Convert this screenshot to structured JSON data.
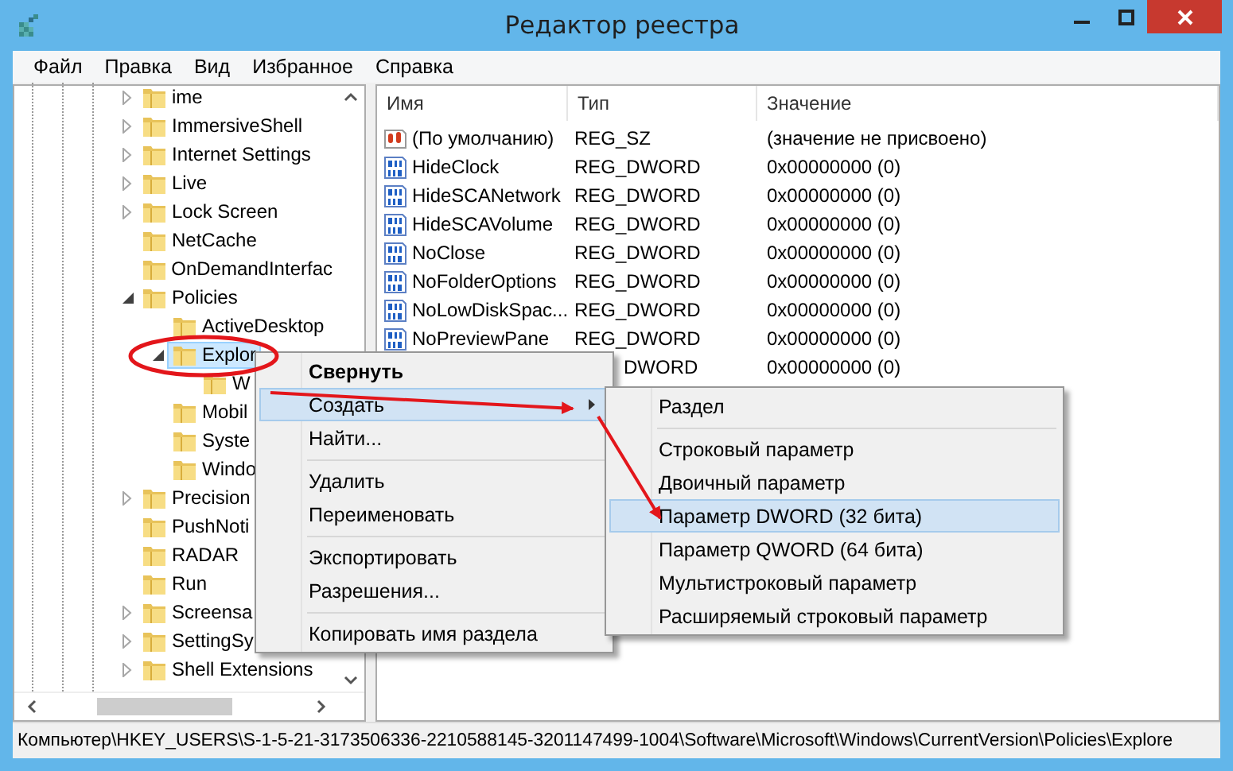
{
  "window": {
    "title": "Редактор реестра"
  },
  "menu_bar": [
    "Файл",
    "Правка",
    "Вид",
    "Избранное",
    "Справка"
  ],
  "tree": {
    "items": [
      {
        "label": "ime",
        "expanded": false,
        "selected": false
      },
      {
        "label": "ImmersiveShell",
        "expanded": false,
        "selected": false
      },
      {
        "label": "Internet Settings",
        "expanded": false,
        "selected": false
      },
      {
        "label": "Live",
        "expanded": false,
        "selected": false
      },
      {
        "label": "Lock Screen",
        "expanded": false,
        "selected": false
      },
      {
        "label": "NetCache",
        "selected": false
      },
      {
        "label": "OnDemandInterfac",
        "selected": false
      },
      {
        "label": "Policies",
        "expanded": true,
        "selected": false,
        "children": [
          {
            "label": "ActiveDesktop",
            "selected": false
          },
          {
            "label": "Explor",
            "expanded": true,
            "selected": true,
            "children": [
              {
                "label": "W",
                "selected": false
              }
            ]
          },
          {
            "label": "Mobil",
            "selected": false
          },
          {
            "label": "Syste",
            "selected": false
          },
          {
            "label": "Windo",
            "selected": false
          }
        ]
      },
      {
        "label": "Precision",
        "expanded": false,
        "selected": false
      },
      {
        "label": "PushNoti",
        "selected": false
      },
      {
        "label": "RADAR",
        "selected": false
      },
      {
        "label": "Run",
        "selected": false
      },
      {
        "label": "Screensa",
        "expanded": false,
        "selected": false
      },
      {
        "label": "SettingSy",
        "expanded": false,
        "selected": false
      },
      {
        "label": "Shell Extensions",
        "expanded": false,
        "selected": false
      }
    ]
  },
  "list": {
    "columns": [
      "Имя",
      "Тип",
      "Значение"
    ],
    "rows": [
      {
        "kind": "string",
        "name": "(По умолчанию)",
        "type": "REG_SZ",
        "value": "(значение не присвоено)"
      },
      {
        "kind": "dword",
        "name": "HideClock",
        "type": "REG_DWORD",
        "value": "0x00000000 (0)"
      },
      {
        "kind": "dword",
        "name": "HideSCANetwork",
        "type": "REG_DWORD",
        "value": "0x00000000 (0)"
      },
      {
        "kind": "dword",
        "name": "HideSCAVolume",
        "type": "REG_DWORD",
        "value": "0x00000000 (0)"
      },
      {
        "kind": "dword",
        "name": "NoClose",
        "type": "REG_DWORD",
        "value": "0x00000000 (0)"
      },
      {
        "kind": "dword",
        "name": "NoFolderOptions",
        "type": "REG_DWORD",
        "value": "0x00000000 (0)"
      },
      {
        "kind": "dword",
        "name": "NoLowDiskSpac...",
        "type": "REG_DWORD",
        "value": "0x00000000 (0)"
      },
      {
        "kind": "dword",
        "name": "NoPreviewPane",
        "type": "REG_DWORD",
        "value": "0x00000000 (0)"
      },
      {
        "kind": "hidden",
        "type": "DWORD",
        "value": "0x00000000 (0)"
      }
    ]
  },
  "context_menu": {
    "items": [
      {
        "kind": "item",
        "label": "Свернуть",
        "default": true,
        "selected": false,
        "submenu": false
      },
      {
        "kind": "item",
        "label": "Создать",
        "default": false,
        "selected": true,
        "submenu": true
      },
      {
        "kind": "item",
        "label": "Найти...",
        "default": false,
        "selected": false,
        "submenu": false
      },
      {
        "kind": "separator"
      },
      {
        "kind": "item",
        "label": "Удалить",
        "default": false,
        "selected": false,
        "submenu": false
      },
      {
        "kind": "item",
        "label": "Переименовать",
        "default": false,
        "selected": false,
        "submenu": false
      },
      {
        "kind": "separator"
      },
      {
        "kind": "item",
        "label": "Экспортировать",
        "default": false,
        "selected": false,
        "submenu": false
      },
      {
        "kind": "item",
        "label": "Разрешения...",
        "default": false,
        "selected": false,
        "submenu": false
      },
      {
        "kind": "separator"
      },
      {
        "kind": "item",
        "label": "Копировать имя раздела",
        "default": false,
        "selected": false,
        "submenu": false
      }
    ]
  },
  "submenu": {
    "items": [
      {
        "kind": "item",
        "label": "Раздел",
        "selected": false
      },
      {
        "kind": "separator"
      },
      {
        "kind": "item",
        "label": "Строковый параметр",
        "selected": false
      },
      {
        "kind": "item",
        "label": "Двоичный параметр",
        "selected": false
      },
      {
        "kind": "item",
        "label": "Параметр DWORD (32 бита)",
        "selected": true
      },
      {
        "kind": "item",
        "label": "Параметр QWORD (64 бита)",
        "selected": false
      },
      {
        "kind": "item",
        "label": "Мультистроковый параметр",
        "selected": false
      },
      {
        "kind": "item",
        "label": "Расширяемый строковый параметр",
        "selected": false
      }
    ]
  },
  "status_bar": "Компьютер\\HKEY_USERS\\S-1-5-21-3173506336-2210588145-3201147499-1004\\Software\\Microsoft\\Windows\\CurrentVersion\\Policies\\Explore"
}
